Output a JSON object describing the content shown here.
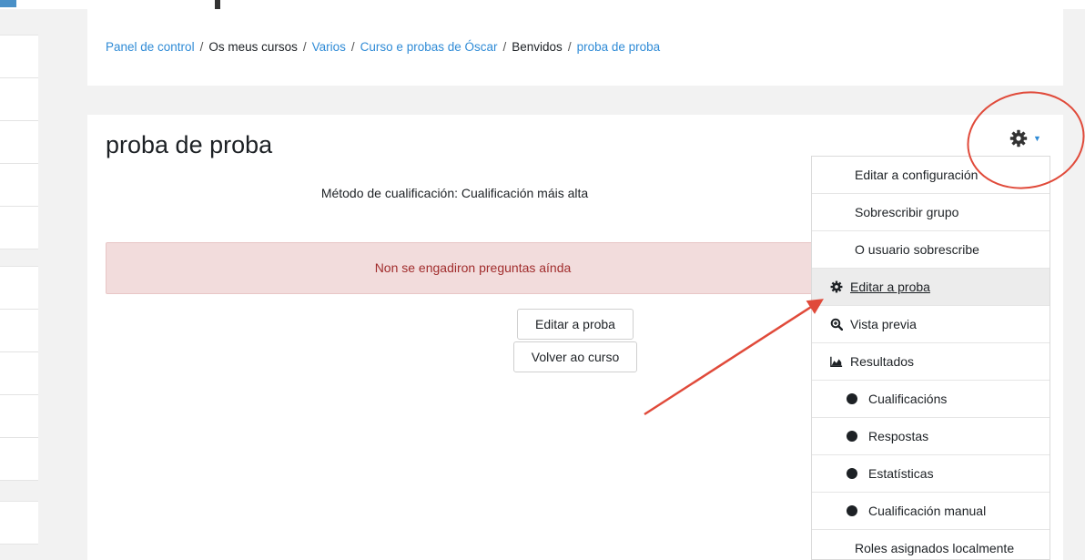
{
  "breadcrumb": {
    "items": [
      {
        "label": "Panel de control",
        "link": true
      },
      {
        "label": "Os meus cursos",
        "link": false
      },
      {
        "label": "Varios",
        "link": true
      },
      {
        "label": "Curso e probas de Óscar",
        "link": true
      },
      {
        "label": "Benvidos",
        "link": false
      },
      {
        "label": "proba de proba",
        "link": true
      }
    ],
    "separator": "/"
  },
  "page": {
    "title": "proba de proba",
    "grading_method": "Método de cualificación: Cualificación máis alta",
    "alert": "Non se engadiron preguntas aínda",
    "edit_button": "Editar a proba",
    "back_button": "Volver ao curso"
  },
  "actions_menu": {
    "trigger_icon": "gear-icon",
    "items": [
      {
        "label": "Editar a configuración"
      },
      {
        "label": "Sobrescribir grupo"
      },
      {
        "label": "O usuario sobrescribe"
      },
      {
        "label": "Editar a proba",
        "icon": "gear-icon",
        "highlighted": true
      },
      {
        "label": "Vista previa",
        "icon": "zoom-icon"
      },
      {
        "label": "Resultados",
        "icon": "chart-icon"
      },
      {
        "label": "Cualificacións",
        "icon": "dot-icon"
      },
      {
        "label": "Respostas",
        "icon": "dot-icon"
      },
      {
        "label": "Estatísticas",
        "icon": "dot-icon"
      },
      {
        "label": "Cualificación manual",
        "icon": "dot-icon"
      },
      {
        "label": "Roles asignados localmente"
      }
    ]
  },
  "annotation": {
    "color": "#e04a3a"
  },
  "colors": {
    "link": "#2f8bd6",
    "alert_bg": "#f2dcdc",
    "alert_text": "#a12d2d"
  }
}
